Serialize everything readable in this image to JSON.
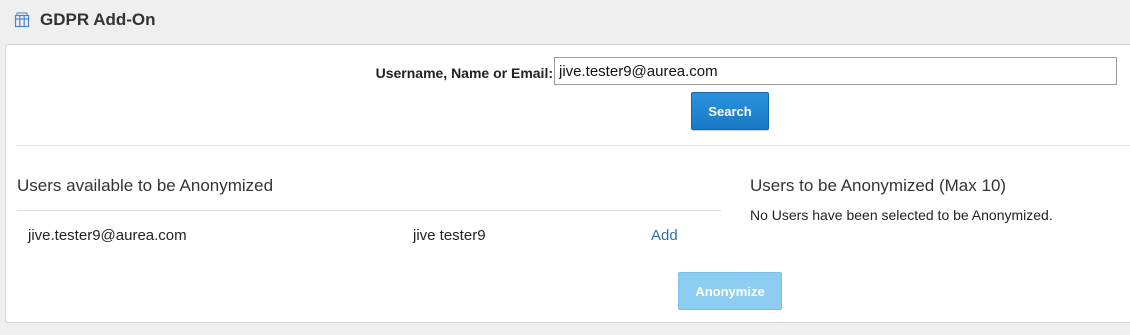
{
  "header": {
    "icon": "gift-box-icon",
    "title": "GDPR Add-On"
  },
  "search": {
    "label": "Username, Name or Email:",
    "value": "jive.tester9@aurea.com",
    "button_label": "Search",
    "accent_color": "#1a79c6"
  },
  "available": {
    "title": "Users available to be Anonymized",
    "rows": [
      {
        "email": "jive.tester9@aurea.com",
        "name": "jive tester9",
        "action": "Add"
      }
    ]
  },
  "selected": {
    "title": "Users to be Anonymized (Max 10)",
    "empty_message": "No Users have been selected to be Anonymized."
  },
  "actions": {
    "anonymize_label": "Anonymize",
    "anonymize_disabled": true
  }
}
